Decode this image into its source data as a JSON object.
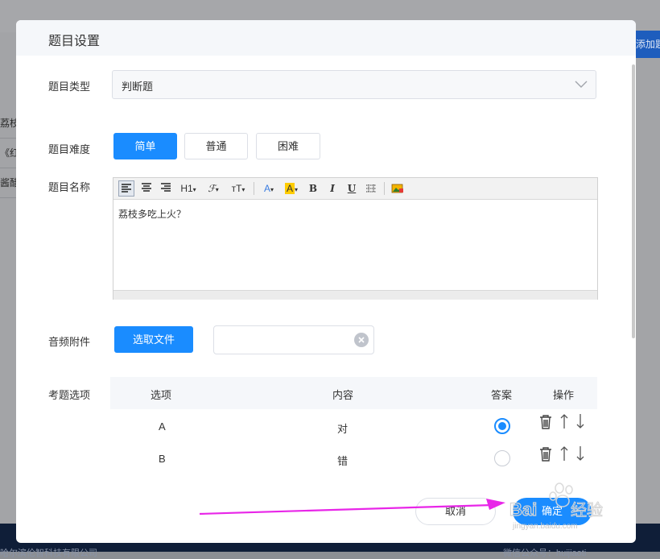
{
  "background": {
    "right_button_label": "添加题",
    "left_rows": [
      "荔枝多",
      "《红楼",
      "酱醋茶"
    ],
    "footer_left": "哈尔滨伦智科技有限公司",
    "footer_right": "微信公众号：huijiaoti"
  },
  "dialog": {
    "title": "题目设置",
    "type_label": "题目类型",
    "type_value": "判断题",
    "difficulty_label": "题目难度",
    "difficulty_options": [
      "简单",
      "普通",
      "困难"
    ],
    "difficulty_selected": "简单",
    "name_label": "题目名称",
    "toolbar": {
      "heading": "H1",
      "font_size": "тT",
      "font_color": "A",
      "highlight": "A",
      "bold": "B",
      "italic": "I",
      "underline": "U"
    },
    "question_text": "荔枝多吃上火？",
    "audio_label": "音频附件",
    "upload_button": "选取文件",
    "file_value": "",
    "options_label": "考题选项",
    "table": {
      "headers": [
        "选项",
        "内容",
        "答案",
        "操作"
      ],
      "rows": [
        {
          "option": "A",
          "content": "对",
          "is_answer": true
        },
        {
          "option": "B",
          "content": "错",
          "is_answer": false
        }
      ]
    },
    "cancel_button": "取消",
    "confirm_button": "确定"
  },
  "annotation": {
    "arrow_color": "#e826e8"
  },
  "watermark": {
    "logo": "Bai经验",
    "url": "jingyan.baidu.com"
  },
  "colors": {
    "primary": "#1a8cff",
    "footer": "#0f1e38"
  }
}
